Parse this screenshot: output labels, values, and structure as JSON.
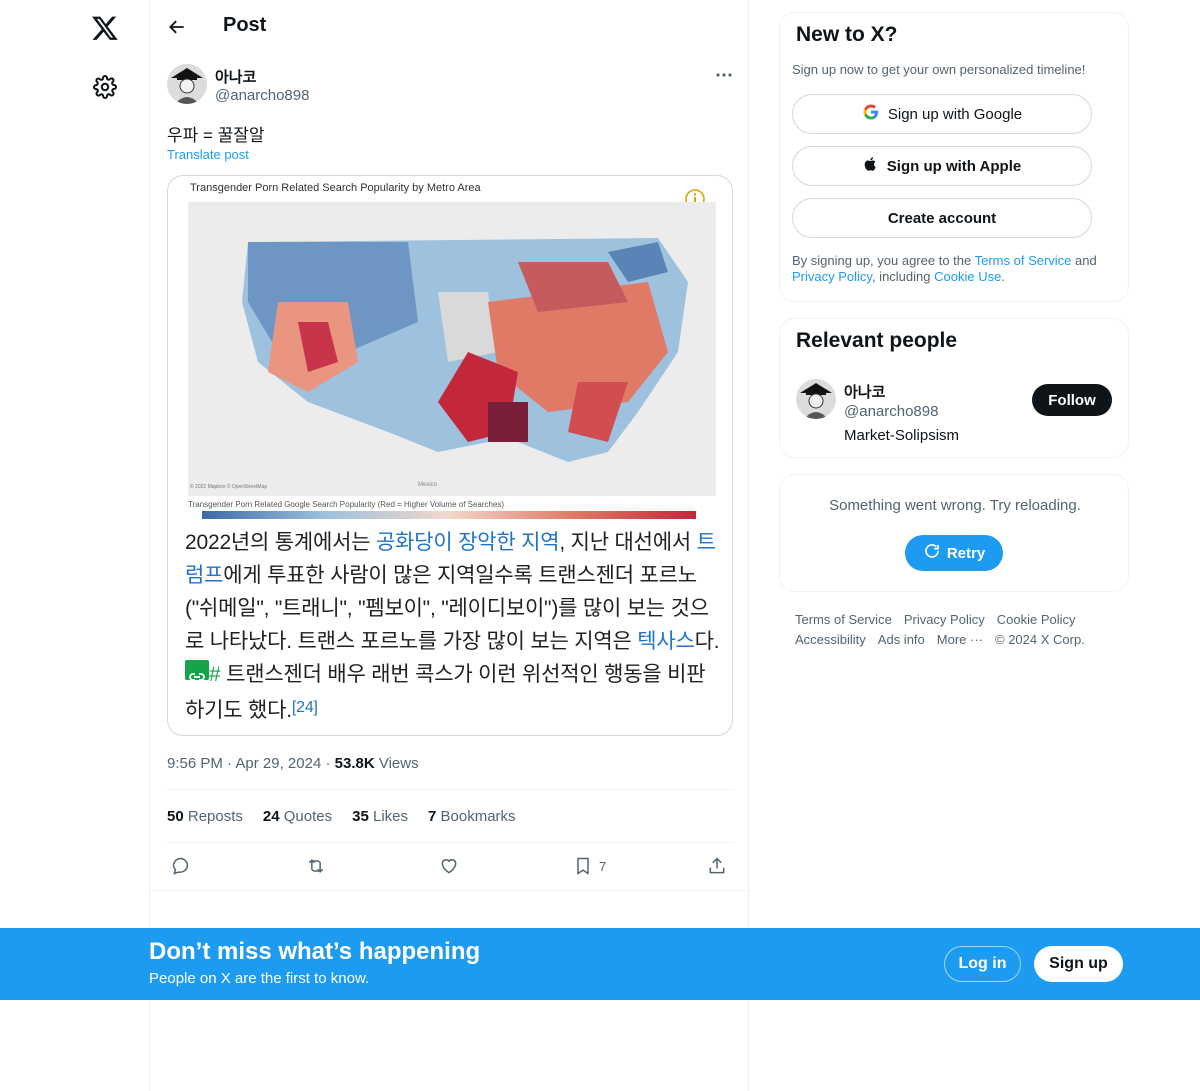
{
  "nav": {
    "logo_icon": "x-logo-icon",
    "settings_icon": "gear-icon"
  },
  "header": {
    "title": "Post"
  },
  "post": {
    "author_name": "아나코",
    "author_handle": "@anarcho898",
    "text": "우파 = 꿀잘알",
    "translate_label": "Translate post",
    "media": {
      "map_title": "Transgender Porn Related Search Popularity by Metro Area",
      "map_footnote": "Transgender Porn Related Google Search Popularity (Red = Higher Volume of Searches)",
      "map_credit": "© 2022 Mapbox © OpenStreetMap",
      "map_place_mexico": "Mexico",
      "caption_1": "2022년의 통계에서는 ",
      "caption_link_1": "공화당이 장악한 지역",
      "caption_2": ", 지난 대선에서 ",
      "caption_link_2": "트럼프",
      "caption_3": "에게 투표한 사람이 많은 지역일수록 트랜스젠더 포르노(\"쉬메일\", \"트래니\", \"펨보이\", \"레이디보이\")를 많이 보는 것으로 나타났다. 트랜스 포르노를 가장 많이 보는 지역은 ",
      "caption_link_3": "텍사스",
      "caption_4": "다.",
      "caption_hash": "#",
      "caption_5": " 트랜스젠더 배우 래번 콕스가 이런 위선적인 행동을 비판하기도 했다.",
      "caption_ref": "[24]"
    },
    "time": "9:56 PM",
    "date": "Apr 29, 2024",
    "views_count": "53.8K",
    "views_label": "Views",
    "stats": {
      "reposts": "50",
      "reposts_label": "Reposts",
      "quotes": "24",
      "quotes_label": "Quotes",
      "likes": "35",
      "likes_label": "Likes",
      "bookmarks": "7",
      "bookmarks_label": "Bookmarks"
    },
    "bookmark_count": "7"
  },
  "signup_card": {
    "title": "New to X?",
    "subtitle": "Sign up now to get your own personalized timeline!",
    "google_label": "Sign up with Google",
    "apple_label": "Sign up with Apple",
    "create_label": "Create account",
    "terms_pre": "By signing up, you agree to the ",
    "terms_link": "Terms of Service",
    "terms_and": " and ",
    "privacy_link": "Privacy Policy",
    "terms_including": ", including ",
    "cookie_link": "Cookie Use",
    "terms_end": "."
  },
  "relevant": {
    "title": "Relevant people",
    "name": "아나코",
    "handle": "@anarcho898",
    "bio": "Market-Solipsism",
    "follow_label": "Follow"
  },
  "error_card": {
    "message": "Something went wrong. Try reloading.",
    "retry_label": "Retry"
  },
  "footer": {
    "links": [
      "Terms of Service",
      "Privacy Policy",
      "Cookie Policy",
      "Accessibility",
      "Ads info",
      "More ···"
    ],
    "copyright": "© 2024 X Corp."
  },
  "banner": {
    "title": "Don’t miss what’s happening",
    "subtitle": "People on X are the first to know.",
    "login_label": "Log in",
    "signup_label": "Sign up"
  },
  "colors": {
    "accent": "#1d9bf0",
    "text": "#0f1419",
    "muted": "#536471"
  }
}
